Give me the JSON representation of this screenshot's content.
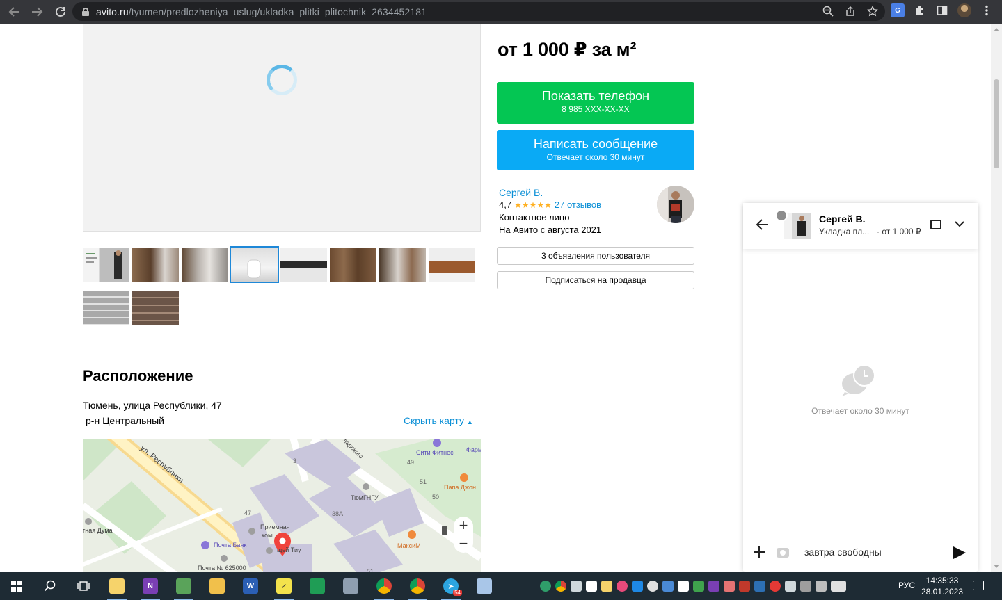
{
  "browser": {
    "url_host": "avito.ru",
    "url_path": "/tyumen/predlozheniya_uslug/ukladka_plitki_plitochnik_2634452181"
  },
  "listing": {
    "price": "от 1 000 ₽ за м²",
    "phone_button": {
      "label": "Показать телефон",
      "sub": "8 985 XXX-XX-XX"
    },
    "message_button": {
      "label": "Написать сообщение",
      "sub": "Отвечает около 30 минут"
    },
    "seller": {
      "name": "Сергей В.",
      "rating": "4,7",
      "stars": "★★★★★",
      "reviews": "27 отзывов",
      "role": "Контактное лицо",
      "since": "На Авито с августа 2021"
    },
    "user_ads_button": "3 объявления пользователя",
    "subscribe_button": "Подписаться на продавца"
  },
  "location": {
    "title": "Расположение",
    "address": "Тюмень, улица Республики, 47",
    "district": "р-н Центральный",
    "hide_map": "Скрыть карту",
    "map_labels": {
      "street": "ул. Республики",
      "city_duma": "гная Дума",
      "pochta_bank": "Почта Банк",
      "pochta": "Почта № 625000",
      "priemnaya": "Приемная",
      "komi": "комі",
      "tiu": "щей Тиу",
      "tgngu": "ТюмГНГУ",
      "city_fitness": "Сити Фитнес",
      "papa": "Папа Джон",
      "maxim": "МаксиМ",
      "farm": "Фарм",
      "street2": "ларского",
      "n3": "3",
      "n47": "47",
      "n38a": "38A",
      "n49": "49",
      "n51": "51",
      "n50": "50",
      "n51b": "51"
    },
    "zoom_in": "+",
    "zoom_out": "−"
  },
  "chat": {
    "name": "Сергей В.",
    "subtitle": "Укладка пл...",
    "price": "· от 1 000 ₽",
    "empty_text": "Отвечает около 30 минут",
    "input_value": "завтра свободны"
  },
  "taskbar": {
    "lang": "РУС",
    "time": "14:35:33",
    "date": "28.01.2023",
    "telegram_badge": "54"
  }
}
